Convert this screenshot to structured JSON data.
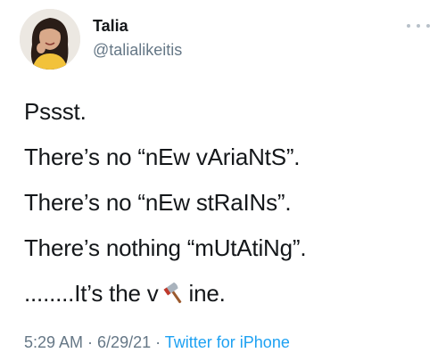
{
  "author": {
    "display_name": "Talia",
    "handle": "@talialikeitis"
  },
  "tweet": {
    "lines": [
      "Pssst.",
      "There’s no “nEw vAriaNtS”.",
      "There’s no “nEw stRaINs”.",
      "There’s nothing “mUtAtiNg”."
    ],
    "last_line_before_emoji": "........It’s the v",
    "emoji": "axe-icon",
    "last_line_after_emoji": "ine."
  },
  "meta": {
    "time": "5:29 AM",
    "separator1": " · ",
    "date": "6/29/21",
    "separator2": " · ",
    "source": "Twitter for iPhone"
  },
  "colors": {
    "text": "#14171a",
    "secondary": "#657786",
    "link": "#1da1f2"
  }
}
